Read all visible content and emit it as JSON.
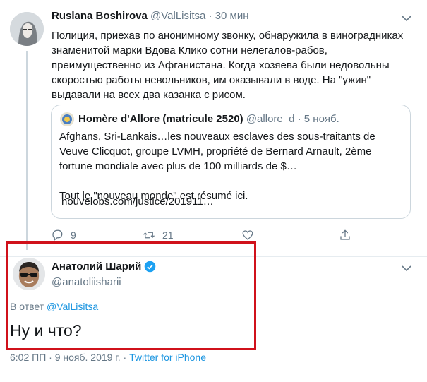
{
  "tweet1": {
    "name": "Ruslana Boshirova",
    "handle": "@ValLisitsa",
    "separator": "·",
    "time": "30 мин",
    "text": "Полиция, приехав по анонимному звонку, обнаружила в виноградниках знаменитой марки Вдова Клико сотни нелегалов-рабов, преимущественно из Афганистана. Когда хозяева были недовольны скоростью работы невольников, им оказывали в воде. На \"ужин\" выдавали на всех два казанка с рисом."
  },
  "quote": {
    "name": "Homère d'Allore (matricule 2520)",
    "handle": "@allore_d",
    "separator": "·",
    "date": "5 нояб.",
    "text1": "Afghans, Sri-Lankais…les nouveaux esclaves des sous-traitants de Veuve Clicquot, groupe LVMH, propriété de Bernard Arnault, 2ème fortune mondiale avec plus de 100 milliards de $…",
    "text2": "Tout le \"nouveau monde\" est résumé ici.",
    "link": "nouvelobs.com/justice/201911…"
  },
  "actions": {
    "reply_count": "9",
    "retweet_count": "21",
    "like_count": "",
    "share_count": ""
  },
  "tweet2": {
    "name": "Анатолий Шарий",
    "handle": "@anatoliisharii",
    "reply_label": "В ответ",
    "reply_handle": "@ValLisitsa",
    "text": "Ну и что?",
    "timestamp": "6:02 ПП · 9 нояб. 2019 г.",
    "separator": "·",
    "source": "Twitter for iPhone"
  },
  "colors": {
    "link": "#1b95e0",
    "muted": "#657786",
    "highlight": "#d0111b",
    "verified": "#1da1f2"
  },
  "icons": [
    "chevron-down-icon",
    "reply-icon",
    "retweet-icon",
    "like-icon",
    "share-icon",
    "verified-icon"
  ]
}
